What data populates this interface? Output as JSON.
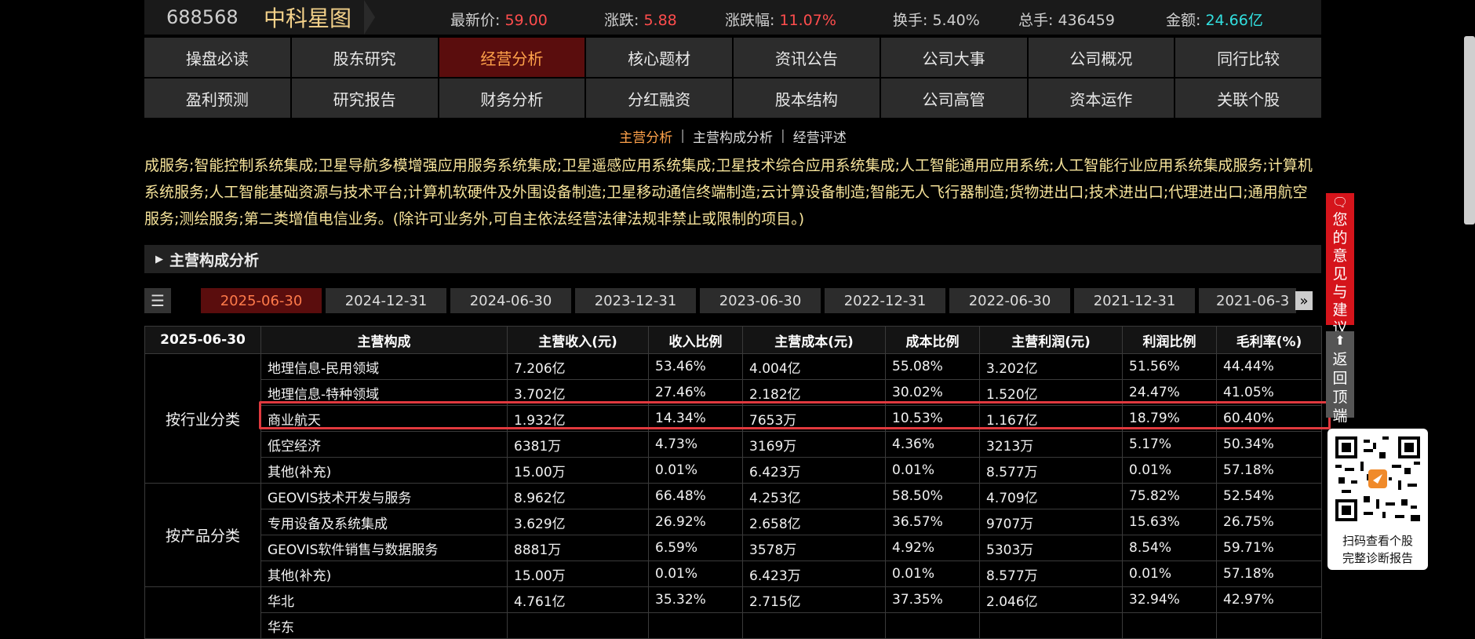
{
  "header": {
    "code": "688568",
    "name": "中科星图",
    "price_label": "最新价:",
    "price": "59.00",
    "chg_label": "涨跌:",
    "chg": "5.88",
    "pct_label": "涨跌幅:",
    "pct": "11.07%",
    "turnover_label": "换手:",
    "turnover": "5.40%",
    "vol_label": "总手:",
    "vol": "436459",
    "amt_label": "金额:",
    "amt": "24.66亿"
  },
  "nav": {
    "row1": [
      "操盘必读",
      "股东研究",
      "经营分析",
      "核心题材",
      "资讯公告",
      "公司大事",
      "公司概况",
      "同行比较"
    ],
    "row2": [
      "盈利预测",
      "研究报告",
      "财务分析",
      "分红融资",
      "股本结构",
      "公司高管",
      "资本运作",
      "关联个股"
    ]
  },
  "subnav": [
    "主营分析",
    "主营构成分析",
    "经营评述"
  ],
  "scope": "成服务;智能控制系统集成;卫星导航多模增强应用服务系统集成;卫星遥感应用系统集成;卫星技术综合应用系统集成;人工智能通用应用系统;人工智能行业应用系统集成服务;计算机系统服务;人工智能基础资源与技术平台;计算机软硬件及外围设备制造;卫星移动通信终端制造;云计算设备制造;智能无人飞行器制造;货物进出口;技术进出口;代理进出口;通用航空服务;测绘服务;第二类增值电信业务。(除许可业务外,可自主依法经营法律法规非禁止或限制的项目。)",
  "section_title": "主营构成分析",
  "dates": [
    "2025-06-30",
    "2024-12-31",
    "2024-06-30",
    "2023-12-31",
    "2023-06-30",
    "2022-12-31",
    "2022-06-30",
    "2021-12-31",
    "2021-06-3"
  ],
  "table": {
    "headers": [
      "2025-06-30",
      "主营构成",
      "主营收入(元)",
      "收入比例",
      "主营成本(元)",
      "成本比例",
      "主营利润(元)",
      "利润比例",
      "毛利率(%)"
    ],
    "groups": [
      {
        "label": "按行业分类",
        "rows": [
          [
            "地理信息-民用领域",
            "7.206亿",
            "53.46%",
            "4.004亿",
            "55.08%",
            "3.202亿",
            "51.56%",
            "44.44%"
          ],
          [
            "地理信息-特种领域",
            "3.702亿",
            "27.46%",
            "2.182亿",
            "30.02%",
            "1.520亿",
            "24.47%",
            "41.05%"
          ],
          [
            "商业航天",
            "1.932亿",
            "14.34%",
            "7653万",
            "10.53%",
            "1.167亿",
            "18.79%",
            "60.40%"
          ],
          [
            "低空经济",
            "6381万",
            "4.73%",
            "3169万",
            "4.36%",
            "3213万",
            "5.17%",
            "50.34%"
          ],
          [
            "其他(补充)",
            "15.00万",
            "0.01%",
            "6.423万",
            "0.01%",
            "8.577万",
            "0.01%",
            "57.18%"
          ]
        ]
      },
      {
        "label": "按产品分类",
        "rows": [
          [
            "GEOVIS技术开发与服务",
            "8.962亿",
            "66.48%",
            "4.253亿",
            "58.50%",
            "4.709亿",
            "75.82%",
            "52.54%"
          ],
          [
            "专用设备及系统集成",
            "3.629亿",
            "26.92%",
            "2.658亿",
            "36.57%",
            "9707万",
            "15.63%",
            "26.75%"
          ],
          [
            "GEOVIS软件销售与数据服务",
            "8881万",
            "6.59%",
            "3578万",
            "4.92%",
            "5303万",
            "8.54%",
            "59.71%"
          ],
          [
            "其他(补充)",
            "15.00万",
            "0.01%",
            "6.423万",
            "0.01%",
            "8.577万",
            "0.01%",
            "57.18%"
          ]
        ]
      },
      {
        "label": "",
        "rows": [
          [
            "华北",
            "4.761亿",
            "35.32%",
            "2.715亿",
            "37.35%",
            "2.046亿",
            "32.94%",
            "42.97%"
          ],
          [
            "华东",
            "",
            "",
            "",
            "",
            "",
            "",
            ""
          ]
        ]
      }
    ]
  },
  "sidebar": {
    "feedback": "您的意见与建议",
    "back_top": "返回顶端",
    "qr_caption_1": "扫码查看个股",
    "qr_caption_2": "完整诊断报告"
  }
}
